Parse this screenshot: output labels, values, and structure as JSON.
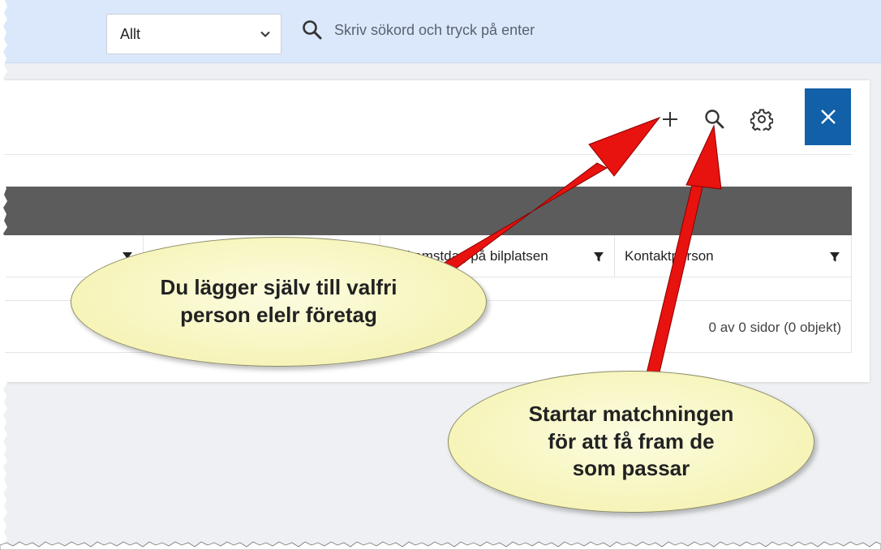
{
  "topbar": {
    "select": {
      "value": "Allt"
    },
    "search": {
      "placeholder": "Skriv sökord och tryck på enter"
    }
  },
  "panel": {
    "toolbar": {
      "add_icon": "plus-icon",
      "search_icon": "search-icon",
      "settings_icon": "gear-icon",
      "close_icon": "close-icon"
    },
    "columns": [
      {
        "label": ""
      },
      {
        "label": ""
      },
      {
        "label": "Ankomstdag på bilplatsen"
      },
      {
        "label": "Kontaktperson"
      }
    ],
    "pager": {
      "info": "0 av 0 sidor (0 objekt)"
    }
  },
  "annotations": {
    "callout_add": {
      "line1": "Du lägger själv till valfri",
      "line2": "person elelr företag"
    },
    "callout_search": {
      "line1": "Startar matchningen",
      "line2": "för att få fram de",
      "line3": "som passar"
    }
  },
  "colors": {
    "topbar_bg": "#dbe8fb",
    "close_button": "#1160a8",
    "group_bar": "#5c5c5c",
    "arrow": "#e8120f",
    "callout_fill": "#f6f4b8"
  }
}
